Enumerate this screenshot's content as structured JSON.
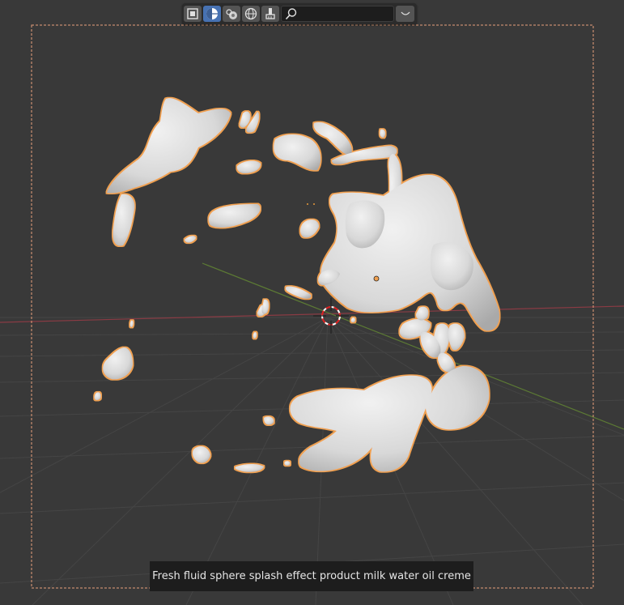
{
  "viewport": {
    "toolbar": {
      "buttons": [
        {
          "name": "wireframe-shading-button",
          "active": false
        },
        {
          "name": "solid-shading-button",
          "active": true
        },
        {
          "name": "material-preview-button",
          "active": false
        },
        {
          "name": "rendered-shading-button",
          "active": false
        },
        {
          "name": "brush-tool-button",
          "active": false
        }
      ],
      "search_value": "",
      "search_placeholder": ""
    },
    "caption": "Fresh fluid sphere splash effect product milk water oil creme"
  },
  "colors": {
    "background": "#393939",
    "grid": "#454545",
    "x_axis": "#8a3b44",
    "y_axis": "#5c7a34",
    "selection_outline": "#f0a050",
    "object_fill": "#d9d9d9",
    "active_button": "#4772b3"
  }
}
